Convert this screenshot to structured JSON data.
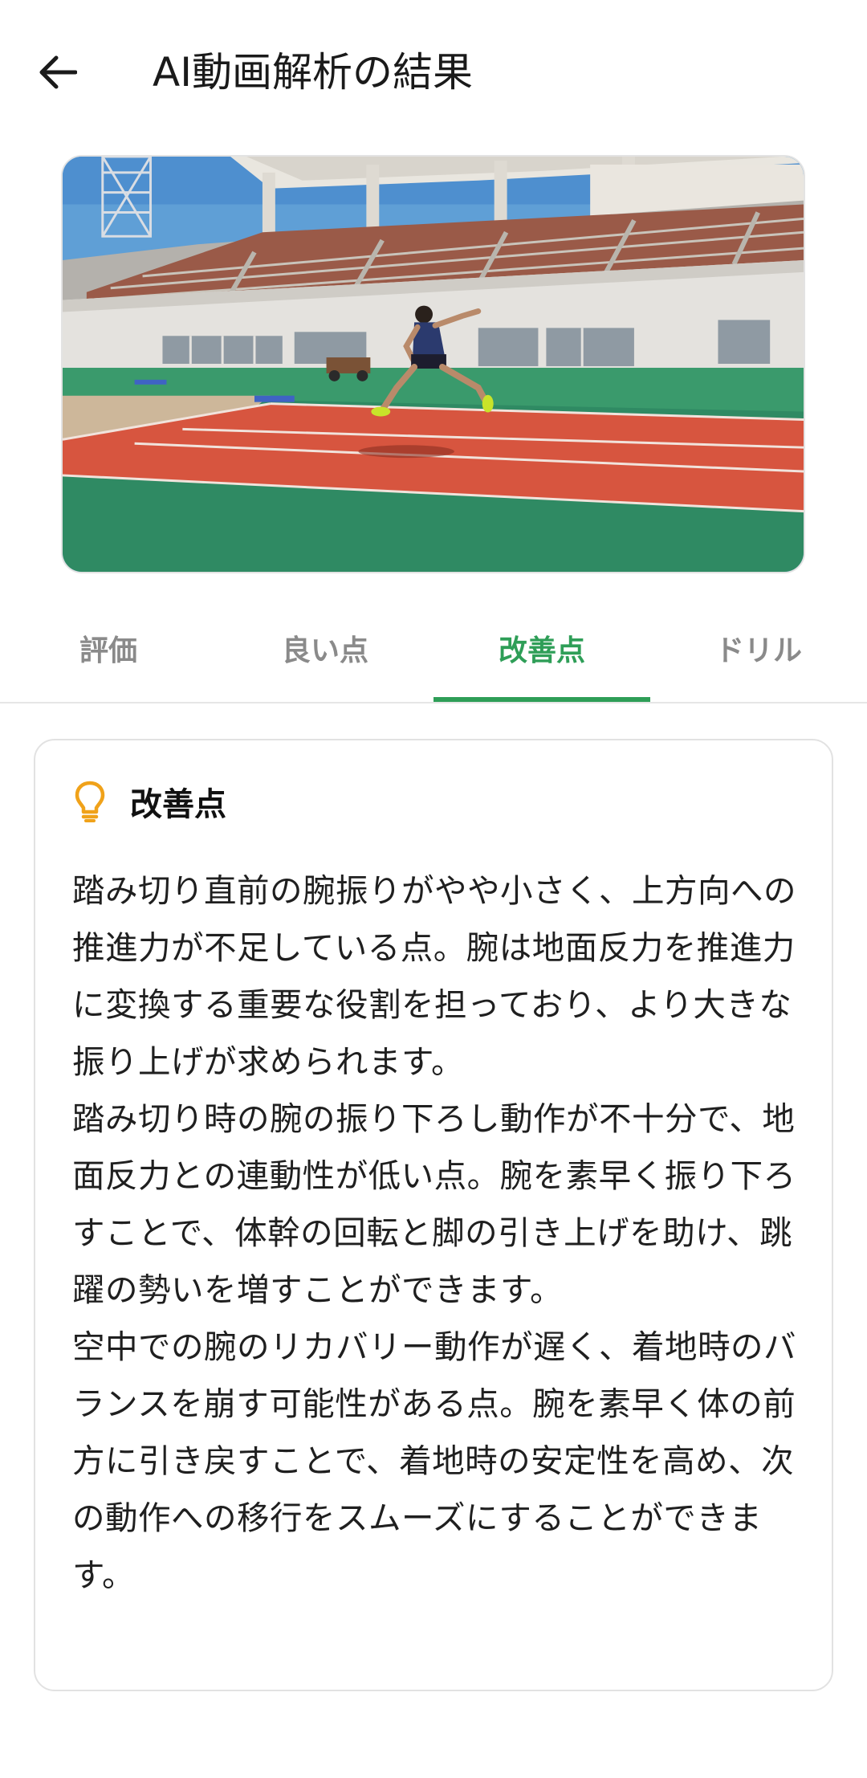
{
  "header": {
    "title": "AI動画解析の結果",
    "back_icon": "arrow-left-icon"
  },
  "tabs": [
    {
      "label": "評価",
      "active": false
    },
    {
      "label": "良い点",
      "active": false
    },
    {
      "label": "改善点",
      "active": true
    },
    {
      "label": "ドリル",
      "active": false
    }
  ],
  "card": {
    "icon": "lightbulb-icon",
    "title": "改善点",
    "body": "踏み切り直前の腕振りがやや小さく、上方向への推進力が不足している点。腕は地面反力を推進力に変換する重要な役割を担っており、より大きな振り上げが求められます。\n踏み切り時の腕の振り下ろし動作が不十分で、地面反力との連動性が低い点。腕を素早く振り下ろすことで、体幹の回転と脚の引き上げを助け、跳躍の勢いを増すことができます。\n空中での腕のリカバリー動作が遅く、着地時のバランスを崩す可能性がある点。腕を素早く体の前方に引き戻すことで、着地時の安定性を高め、次の動作への移行をスムーズにすることができます。"
  },
  "colors": {
    "accent": "#2e9e57",
    "bulb": "#f0a21a",
    "tab_inactive": "#8a8a8a",
    "track": "#d7553f",
    "field": "#2f8a63"
  }
}
